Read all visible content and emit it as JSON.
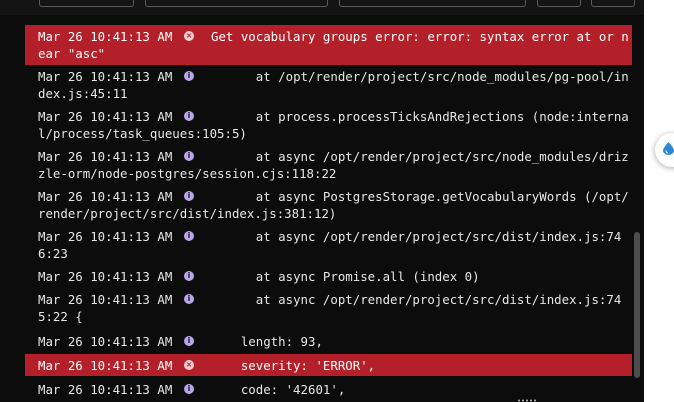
{
  "logs": [
    {
      "time": "Mar 26 10:41:13 AM",
      "level": "error",
      "icon": "error-x-icon",
      "text": "Get vocabulary groups error: error: syntax error at or near \"asc\""
    },
    {
      "time": "Mar 26 10:41:13 AM",
      "level": "info",
      "icon": "info-icon",
      "text": "      at /opt/render/project/src/node_modules/pg-pool/index.js:45:11"
    },
    {
      "time": "Mar 26 10:41:13 AM",
      "level": "info",
      "icon": "info-icon",
      "text": "      at process.processTicksAndRejections (node:internal/process/task_queues:105:5)"
    },
    {
      "time": "Mar 26 10:41:13 AM",
      "level": "info",
      "icon": "info-icon",
      "text": "      at async /opt/render/project/src/node_modules/drizzle-orm/node-postgres/session.cjs:118:22"
    },
    {
      "time": "Mar 26 10:41:13 AM",
      "level": "info",
      "icon": "info-icon",
      "text": "      at async PostgresStorage.getVocabularyWords (/opt/render/project/src/dist/index.js:381:12)"
    },
    {
      "time": "Mar 26 10:41:13 AM",
      "level": "info",
      "icon": "info-icon",
      "text": "      at async /opt/render/project/src/dist/index.js:746:23"
    },
    {
      "time": "Mar 26 10:41:13 AM",
      "level": "info",
      "icon": "info-icon",
      "text": "      at async Promise.all (index 0)"
    },
    {
      "time": "Mar 26 10:41:13 AM",
      "level": "info",
      "icon": "info-icon",
      "text": "      at async /opt/render/project/src/dist/index.js:745:22 {"
    },
    {
      "time": "Mar 26 10:41:13 AM",
      "level": "info",
      "icon": "info-icon",
      "text": "    length: 93,"
    },
    {
      "time": "Mar 26 10:41:13 AM",
      "level": "error",
      "icon": "error-x-icon",
      "text": "    severity: 'ERROR',"
    },
    {
      "time": "Mar 26 10:41:13 AM",
      "level": "info",
      "icon": "info-icon",
      "text": "    code: '42601',"
    }
  ],
  "colors": {
    "background": "#0c0c0c",
    "error_row": "#b3202a",
    "info_icon": "#b8a8e8",
    "text": "#e6e6e6"
  },
  "floating_button": {
    "icon": "water-drop-icon"
  }
}
